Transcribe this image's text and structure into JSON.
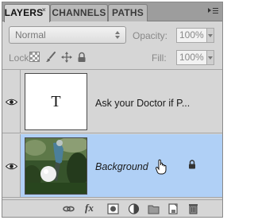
{
  "tabs": [
    {
      "label": "LAYERS",
      "active": true
    },
    {
      "label": "CHANNELS",
      "active": false
    },
    {
      "label": "PATHS",
      "active": false
    }
  ],
  "tab_close_glyph": "×",
  "options": {
    "blend_mode": "Normal",
    "opacity_label": "Opacity:",
    "opacity_value": "100%",
    "lock_label": "Lock:",
    "fill_label": "Fill:",
    "fill_value": "100%"
  },
  "layers": [
    {
      "name": "Ask your Doctor if P...",
      "thumb_text": "T",
      "type": "text",
      "visible": true,
      "selected": false
    },
    {
      "name": "Background",
      "type": "image",
      "visible": true,
      "selected": true,
      "locked": true
    }
  ],
  "bottom_icons": [
    "link-layers-icon",
    "fx-icon",
    "layer-mask-icon",
    "adjustment-layer-icon",
    "group-folder-icon",
    "new-layer-icon",
    "trash-icon"
  ],
  "fx_label": "fx",
  "colors": {
    "panel_bg": "#d6d6d6",
    "tab_bar_bg": "#9d9d9d",
    "selected_layer_bg": "#b0d0f6"
  }
}
